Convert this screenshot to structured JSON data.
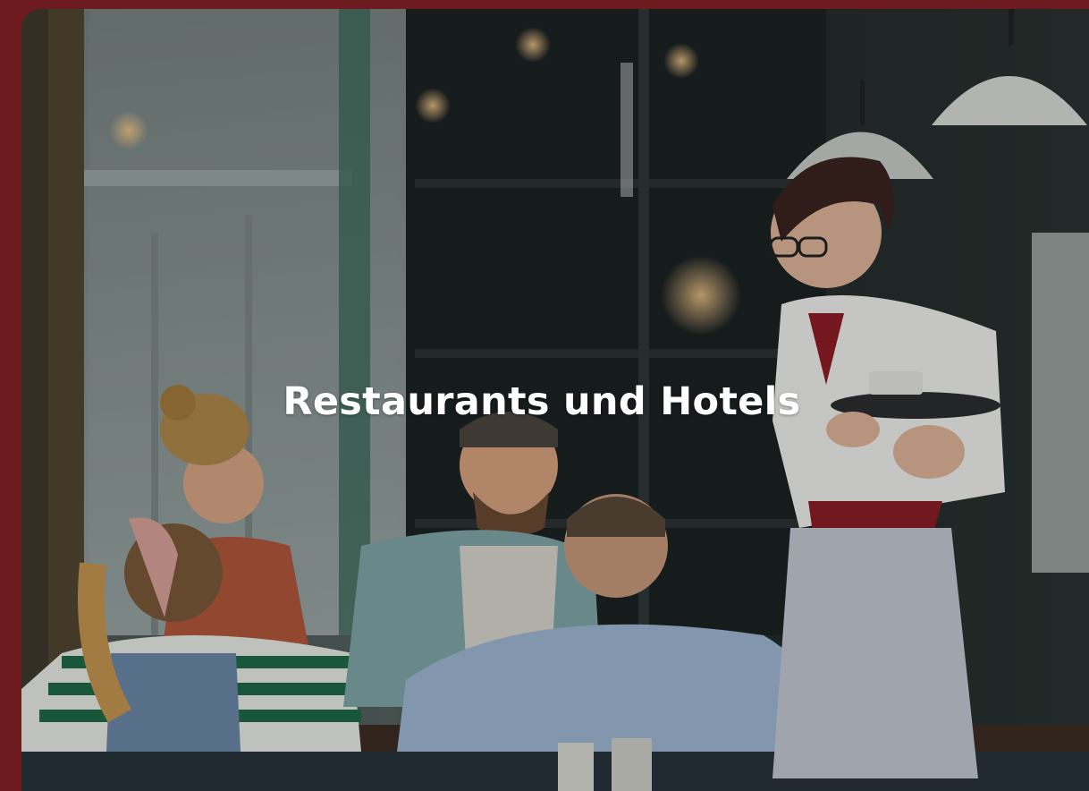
{
  "hero": {
    "title": "Restaurants und Hotels"
  },
  "colors": {
    "frame_border": "#6e1b20",
    "title_text": "#ffffff"
  },
  "image": {
    "icon": "restaurant-family-waitress-photo"
  }
}
